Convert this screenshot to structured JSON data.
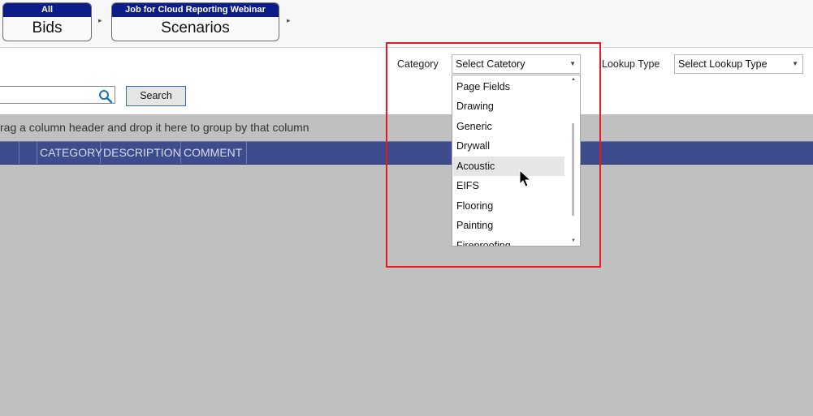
{
  "breadcrumbs": [
    {
      "header": "All",
      "label": "Bids"
    },
    {
      "header": "Job for Cloud Reporting Webinar",
      "label": "Scenarios"
    }
  ],
  "filters": {
    "category_label": "Category",
    "category_value": "Select Catetory",
    "lookup_label": "Lookup Type",
    "lookup_value": "Select Lookup Type"
  },
  "search": {
    "button_label": "Search",
    "value": ""
  },
  "grid": {
    "group_hint": "rag a column header and drop it here to group by that column",
    "columns": [
      "CATEGORY",
      "DESCRIPTION",
      "COMMENT"
    ]
  },
  "dropdown": {
    "items": [
      "Page Fields",
      "Drawing",
      "Generic",
      "Drywall",
      "Acoustic",
      "EIFS",
      "Flooring",
      "Painting",
      "Fireproofing"
    ],
    "hovered": "Acoustic"
  },
  "colors": {
    "breadcrumb_header": "#0c1d8a",
    "grid_header": "#3e4c8d",
    "annotation_box": "#e31b23"
  }
}
